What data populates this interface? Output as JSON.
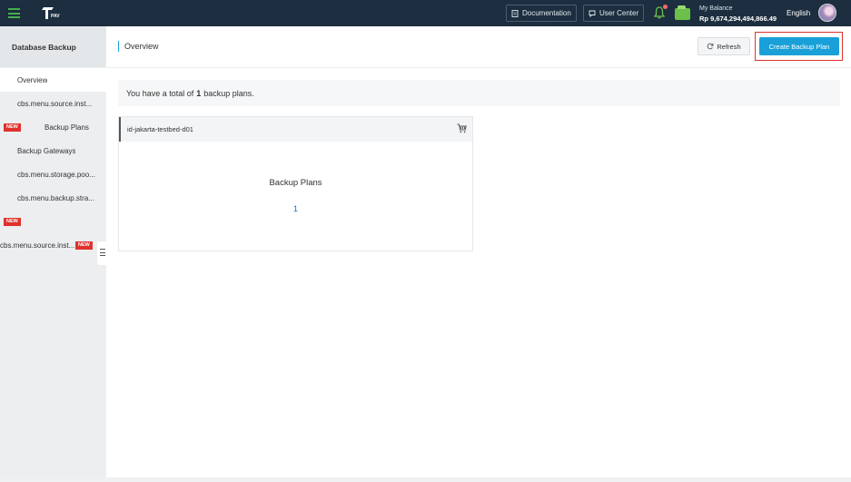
{
  "topbar": {
    "logo_text": "PAV",
    "documentation_label": "Documentation",
    "user_center_label": "User Center",
    "balance_label": "My Balance",
    "balance_value": "Rp 9,674,294,494,866.49",
    "language": "English"
  },
  "sidebar": {
    "title": "Database Backup",
    "items": [
      {
        "label": "Overview",
        "badge": ""
      },
      {
        "label": "cbs.menu.source.inst...",
        "badge": ""
      },
      {
        "label": "Backup Plans",
        "badge": "NEW"
      },
      {
        "label": "Backup Gateways",
        "badge": ""
      },
      {
        "label": "cbs.menu.storage.poo...",
        "badge": ""
      },
      {
        "label": "cbs.menu.backup.stra...",
        "badge": ""
      },
      {
        "label": "",
        "badge": "NEW"
      },
      {
        "label": "cbs.menu.source.inst...",
        "badge": "NEW"
      }
    ]
  },
  "main": {
    "page_title": "Overview",
    "refresh_label": "Refresh",
    "create_label": "Create Backup Plan",
    "summary_prefix": "You have a total of",
    "summary_count": "1",
    "summary_suffix": "backup plans.",
    "card": {
      "region": "id-jakarta-testbed-d01",
      "label": "Backup Plans",
      "count": "1"
    }
  },
  "colors": {
    "topbar_bg": "#1c2e3f",
    "accent": "#1aa0d8",
    "badge_red": "#e0312d",
    "link_blue": "#1a6fc2"
  }
}
